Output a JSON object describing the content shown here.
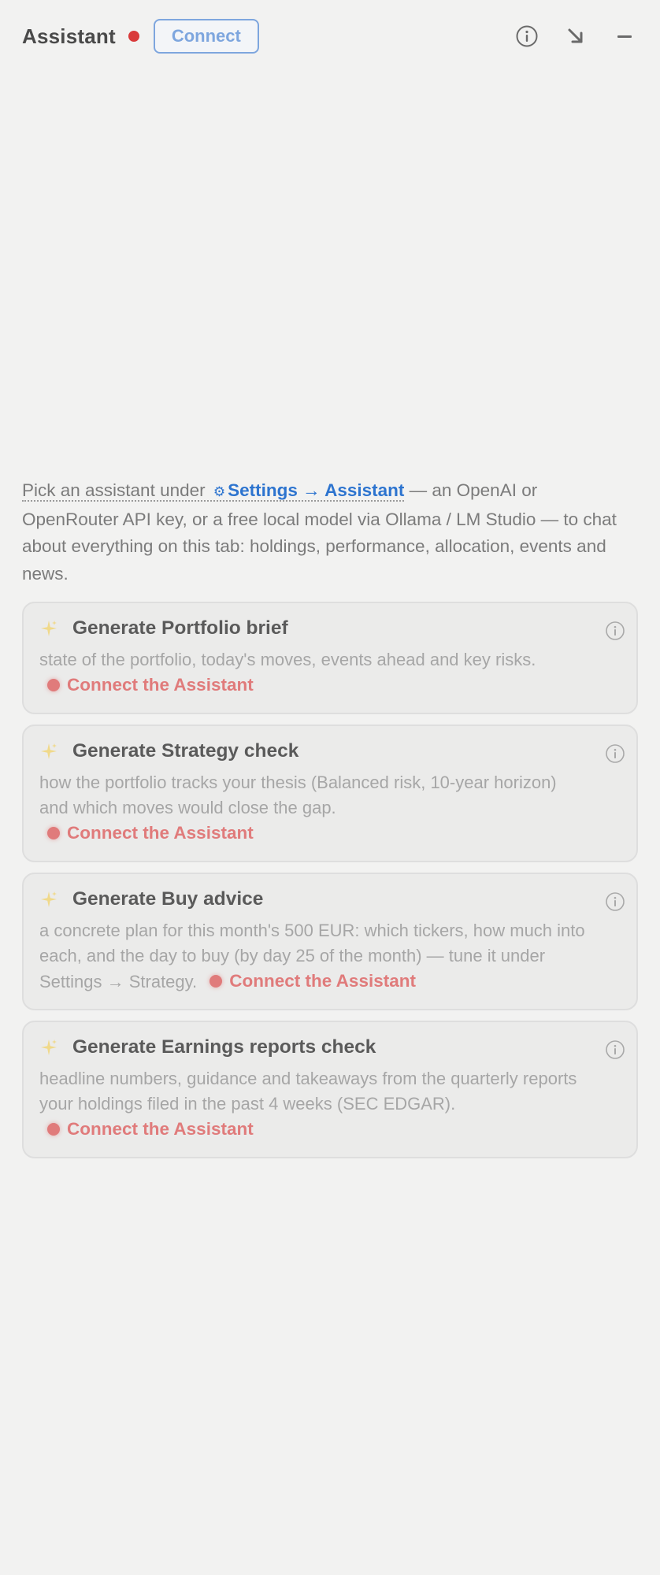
{
  "header": {
    "title": "Assistant",
    "connect_label": "Connect",
    "status_color": "#d93a3a",
    "icons": [
      "info-icon",
      "arrow-down-right-icon",
      "minimize-icon"
    ]
  },
  "intro": {
    "pick_text": "Pick an assistant under",
    "link_text": "Settings → Assistant",
    "rest_text": "— an OpenAI or OpenRouter API key, or a free local model via Ollama / LM Studio — to chat about everything on this tab: holdings, performance, allocation, events and news."
  },
  "cards": [
    {
      "title": "Generate Portfolio brief",
      "desc": "state of the portfolio, today's moves, events ahead and key risks.",
      "cta": "Connect the Assistant"
    },
    {
      "title": "Generate Strategy check",
      "desc": "how the portfolio tracks your thesis (Balanced risk, 10-year horizon) and which moves would close the gap.",
      "cta": "Connect the Assistant"
    },
    {
      "title": "Generate Buy advice",
      "desc": "a concrete plan for this month's 500 EUR: which tickers, how much into each, and the day to buy (by day 25 of the month) — tune it under Settings → Strategy.",
      "cta": "Connect the Assistant"
    },
    {
      "title": "Generate Earnings reports check",
      "desc": "headline numbers, guidance and takeaways from the quarterly reports your holdings filed in the past 4 weeks (SEC EDGAR).",
      "cta": "Connect the Assistant"
    }
  ],
  "colors": {
    "accent": "#2d74cf",
    "cta": "#e07b7b",
    "background": "#f2f2f1"
  }
}
